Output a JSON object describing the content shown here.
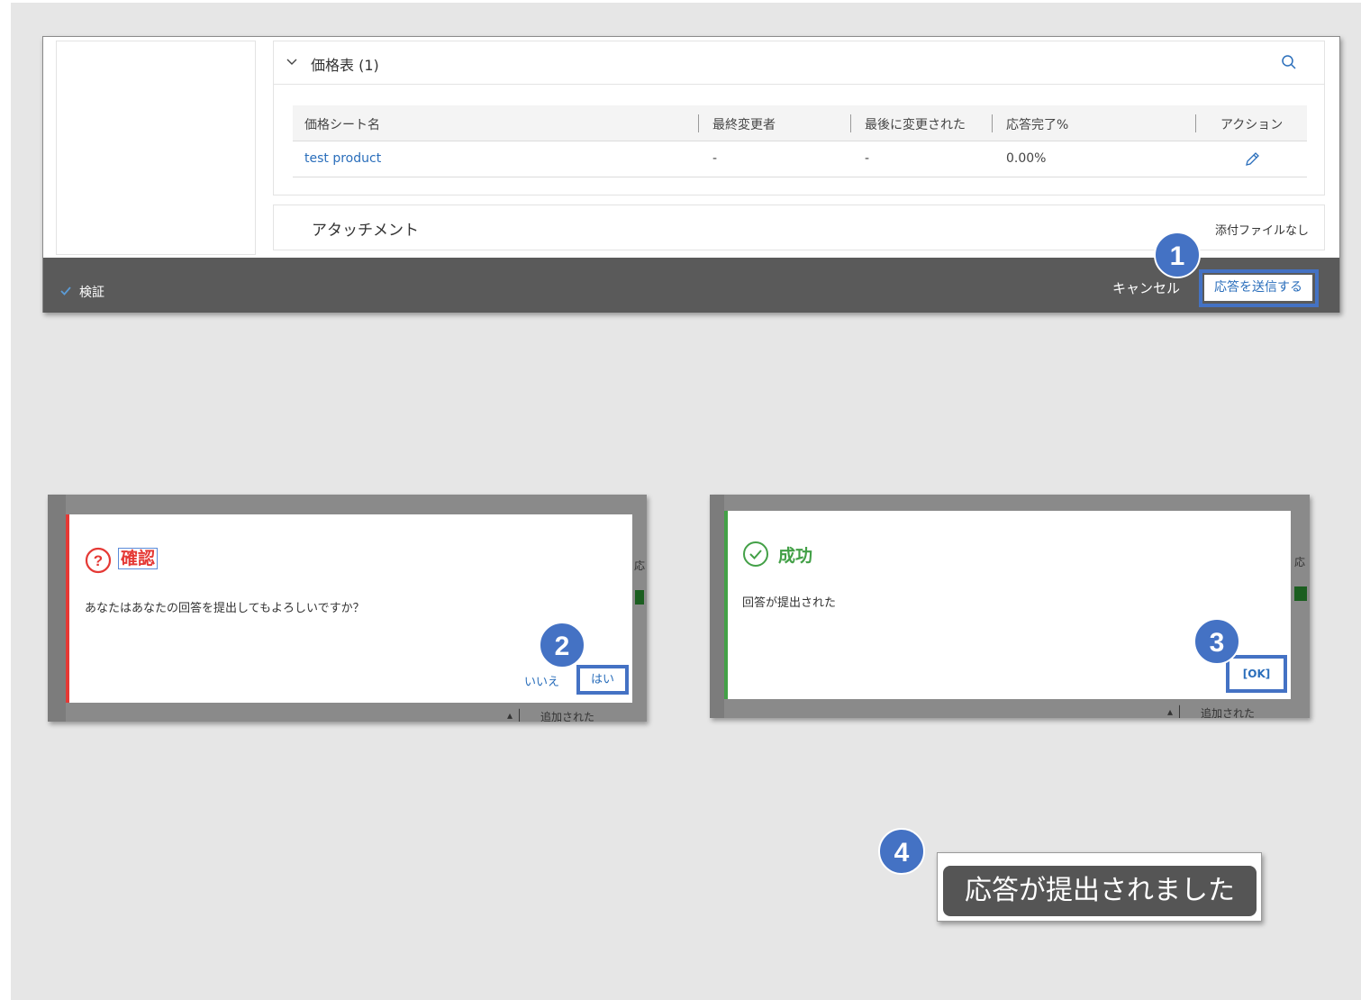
{
  "pricing": {
    "title": "価格表 (1)",
    "columns": [
      "価格シート名",
      "最終変更者",
      "最後に変更された",
      "応答完了%",
      "アクション"
    ],
    "rows": [
      {
        "name": "test product",
        "modifier": "-",
        "modified": "-",
        "progress": "0.00%"
      }
    ]
  },
  "attachments": {
    "title": "アタッチメント",
    "empty_text": "添付ファイルなし"
  },
  "footer": {
    "verify_label": "検証",
    "cancel_label": "キャンセル",
    "submit_label": "応答を送信する"
  },
  "steps": [
    "1",
    "2",
    "3",
    "4"
  ],
  "confirm_dialog": {
    "title": "確認",
    "message": "あなたはあなたの回答を提出してもよろしいですか？",
    "no_label": "いいえ",
    "yes_label": "はい",
    "bg_header_fragment": "応",
    "bg_footer_text": "追加された"
  },
  "success_dialog": {
    "title": "成功",
    "message": "回答が提出された",
    "ok_label": "[OK]",
    "bg_header_fragment": "応",
    "bg_footer_text": "追加された"
  },
  "toast": {
    "message": "応答が提出されました"
  },
  "colors": {
    "accent": "#4472c4",
    "link": "#2a6ebb",
    "error": "#e53935",
    "success": "#43a047",
    "footer_bg": "#5a5a5a"
  },
  "icons": [
    "chevron-down-icon",
    "search-icon",
    "pencil-icon",
    "checkbox-icon",
    "question-icon",
    "check-circle-icon"
  ]
}
